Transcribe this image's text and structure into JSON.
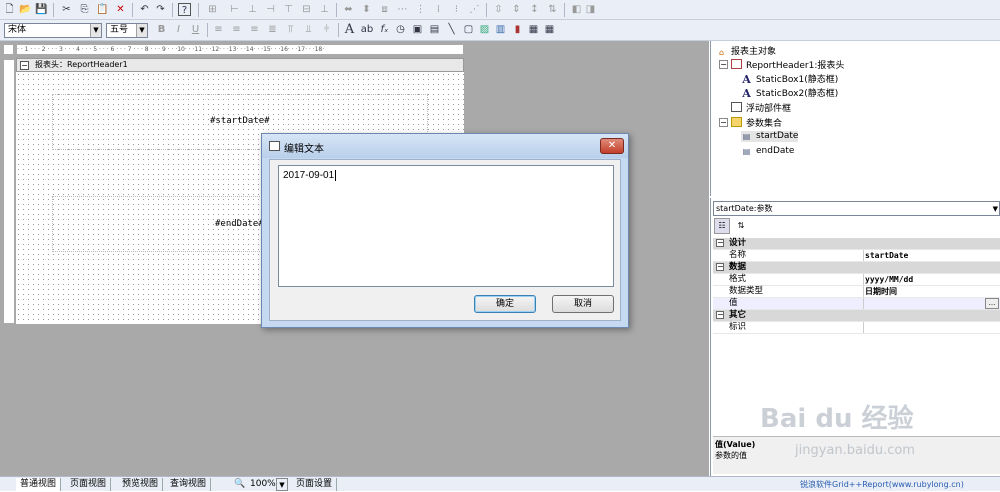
{
  "toolbar1": {
    "icons": [
      "new-icon",
      "open-icon",
      "save-icon",
      "cut-icon",
      "copy-icon",
      "paste-icon",
      "delete-icon",
      "undo-icon",
      "redo-icon",
      "help-icon"
    ]
  },
  "toolbar2": {
    "font": "宋体",
    "size": "五号",
    "bold": "B",
    "italic": "I",
    "underline": "U",
    "text_icon": "A",
    "ab_icon": "ab",
    "fx_icon": "fₓ"
  },
  "design": {
    "band_title": "报表头：ReportHeader1",
    "start_field": "#startDate#",
    "end_field": "#endDate#"
  },
  "dialog": {
    "title": "编辑文本",
    "value": "2017-09-01",
    "ok": "确定",
    "cancel": "取消",
    "close": "✕"
  },
  "tree": {
    "root": "报表主对象",
    "header": "ReportHeader1:报表头",
    "box1": "StaticBox1(静态框)",
    "box2": "StaticBox2(静态框)",
    "float": "浮动部件框",
    "params": "参数集合",
    "p1": "startDate",
    "p2": "endDate"
  },
  "props": {
    "selector": "startDate:参数",
    "cat_design": "设计",
    "name_k": "名称",
    "name_v": "startDate",
    "cat_data": "数据",
    "fmt_k": "格式",
    "fmt_v": "yyyy/MM/dd",
    "type_k": "数据类型",
    "type_v": "日期时间",
    "val_k": "值",
    "val_btn": "...",
    "cat_other": "其它",
    "tag_k": "标识",
    "desc_title": "值(Value)",
    "desc_text": "参数的值"
  },
  "status": {
    "normal": "普通视图",
    "page": "页面视图",
    "preview": "预览视图",
    "query": "查询视图",
    "zoom": "100%",
    "pagesetup": "页面设置",
    "brand": "锐浪软件Grid++Report(www.rubylong.cn)"
  },
  "watermark": {
    "main": "Bai du 经验",
    "sub": "jingyan.baidu.com"
  }
}
